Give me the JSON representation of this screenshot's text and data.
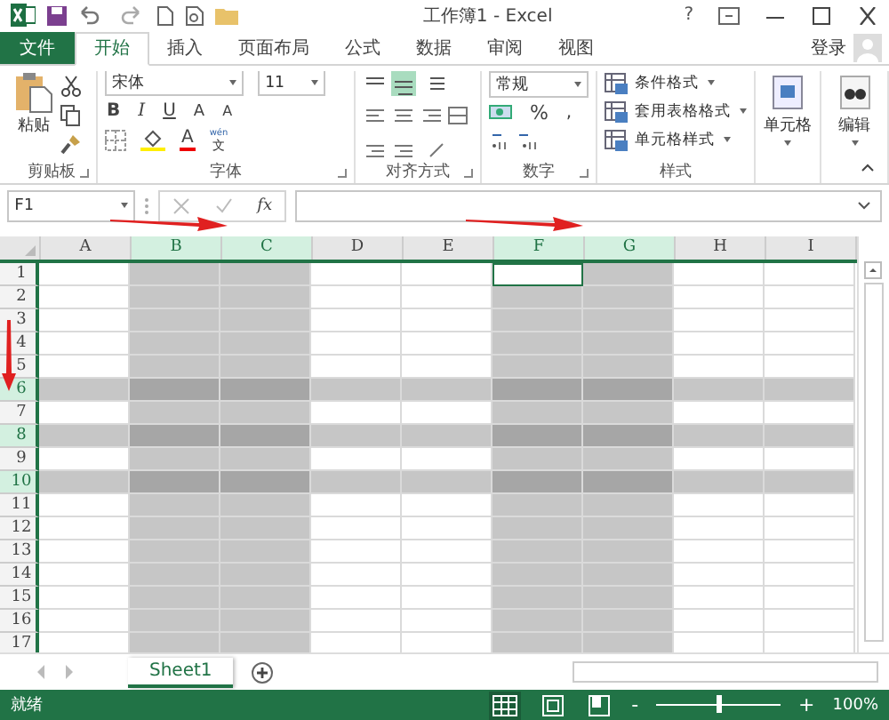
{
  "window": {
    "title": "工作簿1 - Excel",
    "help": "?",
    "signin": "登录"
  },
  "file_tab": {
    "label": "文件"
  },
  "tabs": [
    {
      "label": "开始",
      "kind": "tab",
      "selected": true
    },
    {
      "label": "插入",
      "kind": "tab",
      "selected": false
    },
    {
      "label": "页面布局",
      "kind": "tab",
      "selected": false
    },
    {
      "label": "公式",
      "kind": "tab",
      "selected": false
    },
    {
      "label": "数据",
      "kind": "tab",
      "selected": false
    },
    {
      "label": "审阅",
      "kind": "tab",
      "selected": false
    },
    {
      "label": "视图",
      "kind": "tab",
      "selected": false
    }
  ],
  "ribbon": {
    "clipboard": {
      "paste": "粘贴",
      "label": "剪贴板"
    },
    "font": {
      "name": "宋体",
      "size": "11",
      "bold": "B",
      "italic": "I",
      "underline": "U",
      "grow": "A",
      "shrink": "A",
      "color_letter": "A",
      "phonetic": "wén",
      "phonetic_char": "文",
      "label": "字体"
    },
    "alignment": {
      "label": "对齐方式"
    },
    "number": {
      "format": "常规",
      "percent": "%",
      "comma": ",",
      "label": "数字"
    },
    "styles": {
      "items": [
        "条件格式",
        "套用表格格式",
        "单元格样式"
      ],
      "label": "样式"
    },
    "cells": {
      "label": "单元格"
    },
    "editing": {
      "label": "编辑"
    }
  },
  "formula_bar": {
    "name_box": "F1",
    "fx": "fx"
  },
  "columns": [
    {
      "label": "A",
      "selected": false,
      "active": false
    },
    {
      "label": "B",
      "selected": true,
      "active": false
    },
    {
      "label": "C",
      "selected": true,
      "active": false
    },
    {
      "label": "D",
      "selected": false,
      "active": false
    },
    {
      "label": "E",
      "selected": false,
      "active": false
    },
    {
      "label": "F",
      "selected": true,
      "active": true
    },
    {
      "label": "G",
      "selected": true,
      "active": false
    },
    {
      "label": "H",
      "selected": false,
      "active": false
    },
    {
      "label": "I",
      "selected": false,
      "active": false
    }
  ],
  "rows": [
    {
      "label": "1",
      "selected": false,
      "active": true
    },
    {
      "label": "2",
      "selected": false,
      "active": false
    },
    {
      "label": "3",
      "selected": false,
      "active": false
    },
    {
      "label": "4",
      "selected": false,
      "active": false
    },
    {
      "label": "5",
      "selected": false,
      "active": false
    },
    {
      "label": "6",
      "selected": true,
      "active": false
    },
    {
      "label": "7",
      "selected": false,
      "active": false
    },
    {
      "label": "8",
      "selected": true,
      "active": false
    },
    {
      "label": "9",
      "selected": false,
      "active": false
    },
    {
      "label": "10",
      "selected": true,
      "active": false
    },
    {
      "label": "11",
      "selected": false,
      "active": false
    },
    {
      "label": "12",
      "selected": false,
      "active": false
    },
    {
      "label": "13",
      "selected": false,
      "active": false
    },
    {
      "label": "14",
      "selected": false,
      "active": false
    },
    {
      "label": "15",
      "selected": false,
      "active": false
    },
    {
      "label": "16",
      "selected": false,
      "active": false
    },
    {
      "label": "17",
      "selected": false,
      "active": false
    }
  ],
  "annotation_arrows": [
    {
      "kind": "right"
    },
    {
      "kind": "right"
    },
    {
      "kind": "down"
    }
  ],
  "sheets": [
    {
      "name": "Sheet1",
      "selected": true
    }
  ],
  "status_bar": {
    "status": "就绪",
    "zoom": "100%",
    "zoom_out": "-",
    "zoom_in": "+",
    "zoom_level": {
      "level": 0.5
    }
  }
}
